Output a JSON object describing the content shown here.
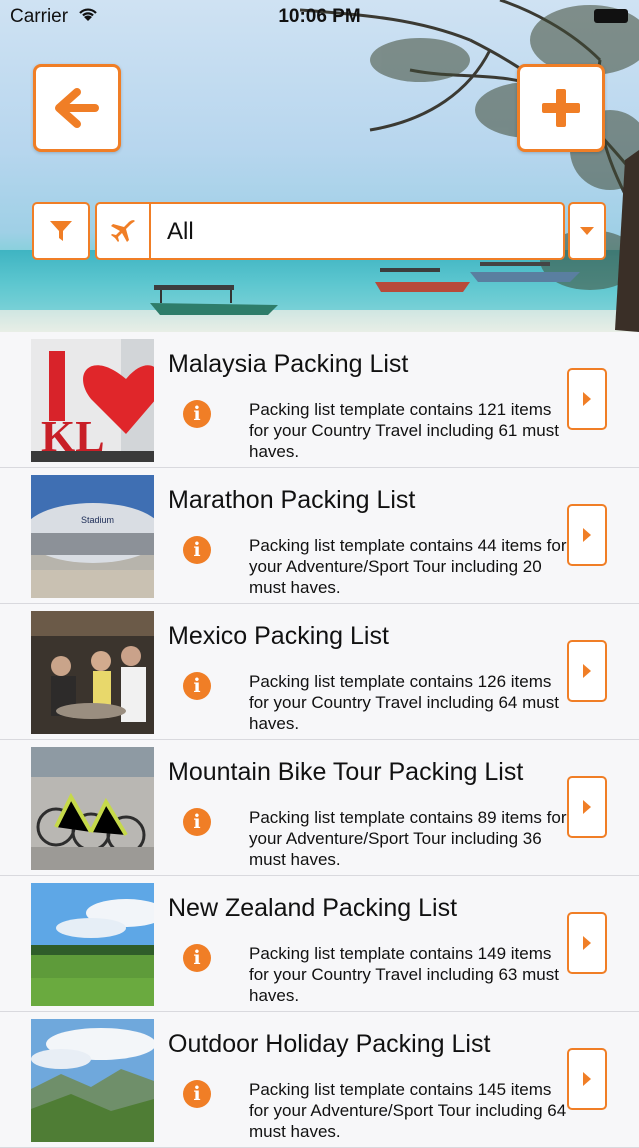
{
  "status_bar": {
    "carrier": "Carrier",
    "time": "10:06 PM"
  },
  "header": {
    "back_icon": "arrow-left-icon",
    "add_icon": "plus-icon",
    "filter_icon": "funnel-icon",
    "category_icon": "airplane-icon",
    "category_value": "All",
    "dropdown_icon": "caret-down-icon"
  },
  "colors": {
    "accent": "#f07e26",
    "background": "#f7f7f9"
  },
  "lists": [
    {
      "title": "Malaysia Packing List",
      "description": "Packing list template contains 121 items for your Country Travel including 61 must haves."
    },
    {
      "title": "Marathon Packing List",
      "description": "Packing list template contains 44 items for your Adventure/Sport Tour including 20 must haves."
    },
    {
      "title": "Mexico Packing List",
      "description": "Packing list template contains 126 items for your Country Travel including 64 must haves."
    },
    {
      "title": "Mountain Bike Tour Packing List",
      "description": "Packing list template contains 89 items for your Adventure/Sport Tour including 36 must haves."
    },
    {
      "title": "New Zealand Packing List",
      "description": "Packing list template contains 149 items for your Country Travel including 63 must haves."
    },
    {
      "title": "Outdoor Holiday Packing List",
      "description": "Packing list template contains 145 items for your Adventure/Sport Tour including 64 must haves."
    }
  ]
}
